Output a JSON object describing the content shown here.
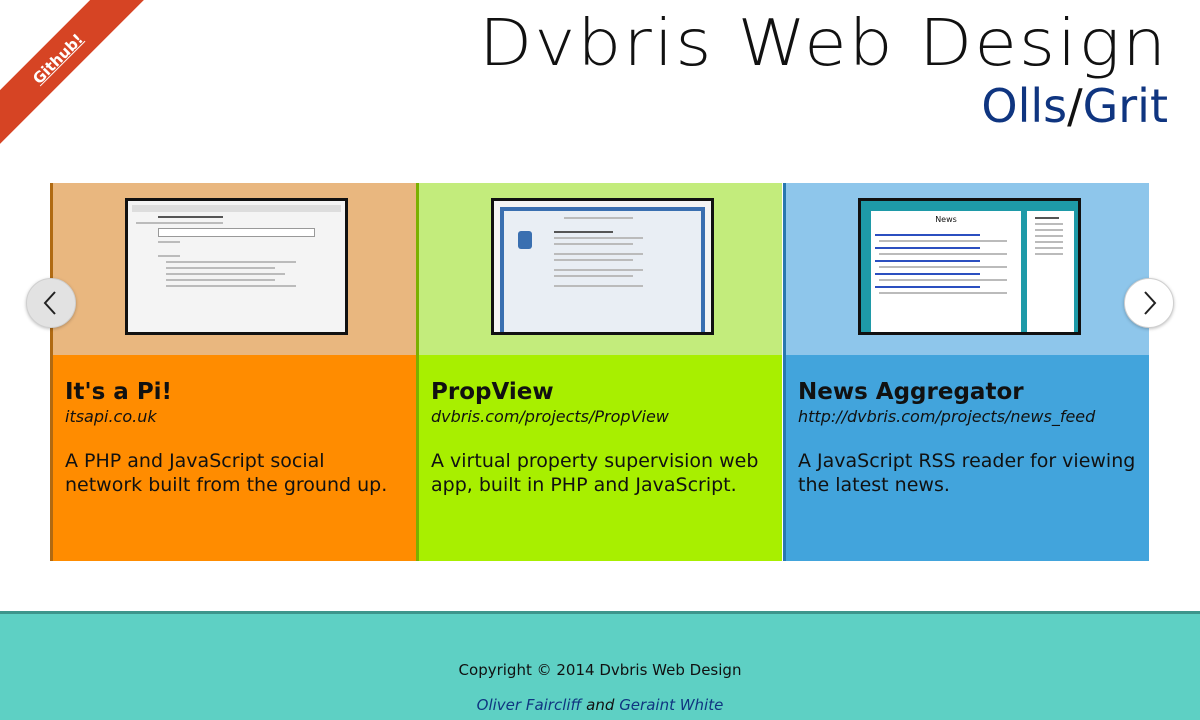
{
  "ribbon": {
    "label": "Github!",
    "color": "#d64424"
  },
  "header": {
    "title": "Dvbris Web Design",
    "subtitle_left": "Olls",
    "subtitle_sep": "/",
    "subtitle_right": "Grit"
  },
  "carousel": {
    "prev_icon": "chevron-left-icon",
    "next_icon": "chevron-right-icon",
    "cards": [
      {
        "title": "It's a Pi!",
        "url": "itsapi.co.uk",
        "description": "A PHP and JavaScript social network built from the ground up.",
        "color": "#ff8c00"
      },
      {
        "title": "PropView",
        "url": "dvbris.com/projects/PropView",
        "description": "A virtual property supervision web app, built in PHP and JavaScript.",
        "color": "#a8ef00"
      },
      {
        "title": "News Aggregator",
        "url": "http://dvbris.com/projects/news_feed",
        "description": "A JavaScript RSS reader for viewing the latest news.",
        "color": "#42a4dc",
        "screenshot_heading": "News"
      }
    ]
  },
  "footer": {
    "copyright": "Copyright © 2014 Dvbris Web Design",
    "author1": "Oliver Faircliff",
    "and": "and",
    "author2": "Geraint White",
    "color": "#5ed0c4"
  }
}
